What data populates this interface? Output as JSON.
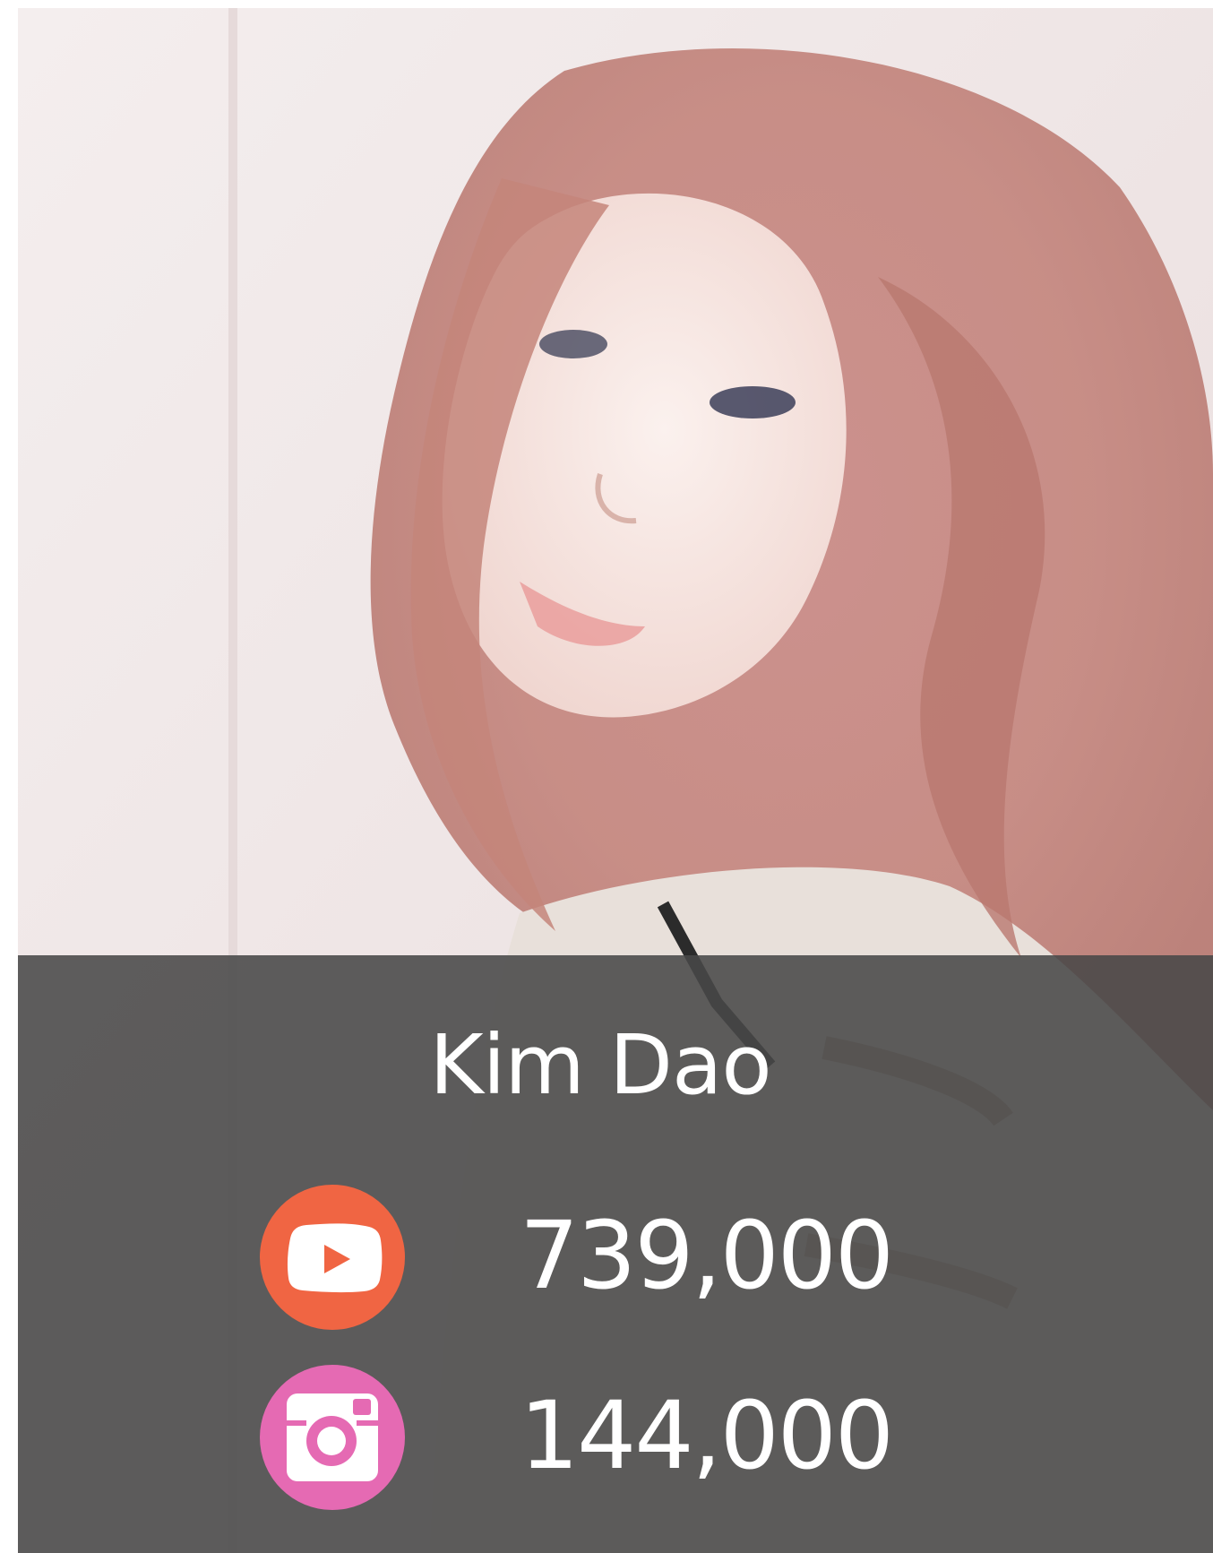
{
  "profile": {
    "name": "Kim Dao"
  },
  "stats": [
    {
      "platform_icon": "youtube-icon",
      "value": "739,000",
      "color": "#f06543"
    },
    {
      "platform_icon": "instagram-icon",
      "value": "144,000",
      "color": "#e56ab3"
    }
  ]
}
